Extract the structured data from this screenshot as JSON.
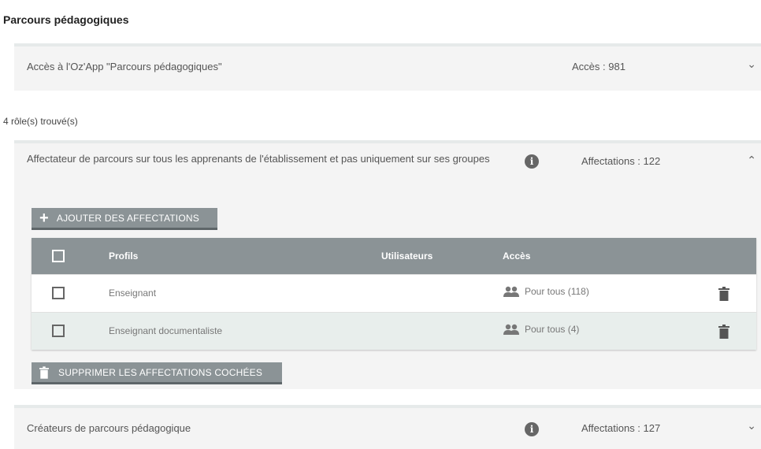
{
  "page": {
    "title": "Parcours pédagogiques"
  },
  "access_panel": {
    "label": "Accès à l'Oz'App \"Parcours pédagogiques\"",
    "count": "Accès : 981"
  },
  "roles_found": "4 rôle(s) trouvé(s)",
  "roles": [
    {
      "name": "Affectateur de parcours sur tous les apprenants de l'établissement et pas uniquement sur ses groupes",
      "count": "Affectations : 122",
      "expanded": true,
      "add_button": "AJOUTER DES AFFECTATIONS",
      "delete_button": "SUPPRIMER LES AFFECTATIONS COCHÉES",
      "table": {
        "headers": [
          "Profils",
          "Utilisateurs",
          "Accès"
        ],
        "rows": [
          {
            "profil": "Enseignant",
            "utilisateurs": "",
            "acces": "Pour tous (118)"
          },
          {
            "profil": "Enseignant documentaliste",
            "utilisateurs": "",
            "acces": "Pour tous (4)"
          }
        ]
      }
    },
    {
      "name": "Créateurs de parcours pédagogique",
      "count": "Affectations : 127",
      "expanded": false
    }
  ],
  "icons": {
    "info": "info-icon",
    "group": "group-icon",
    "trash": "trash-icon",
    "chevron_down": "chevron-down-icon",
    "chevron_up": "chevron-up-icon",
    "plus": "plus-icon"
  },
  "colors": {
    "header_bg": "#8b9396",
    "panel_bg": "#f4f4f4",
    "row_alt": "#e8eeec"
  }
}
